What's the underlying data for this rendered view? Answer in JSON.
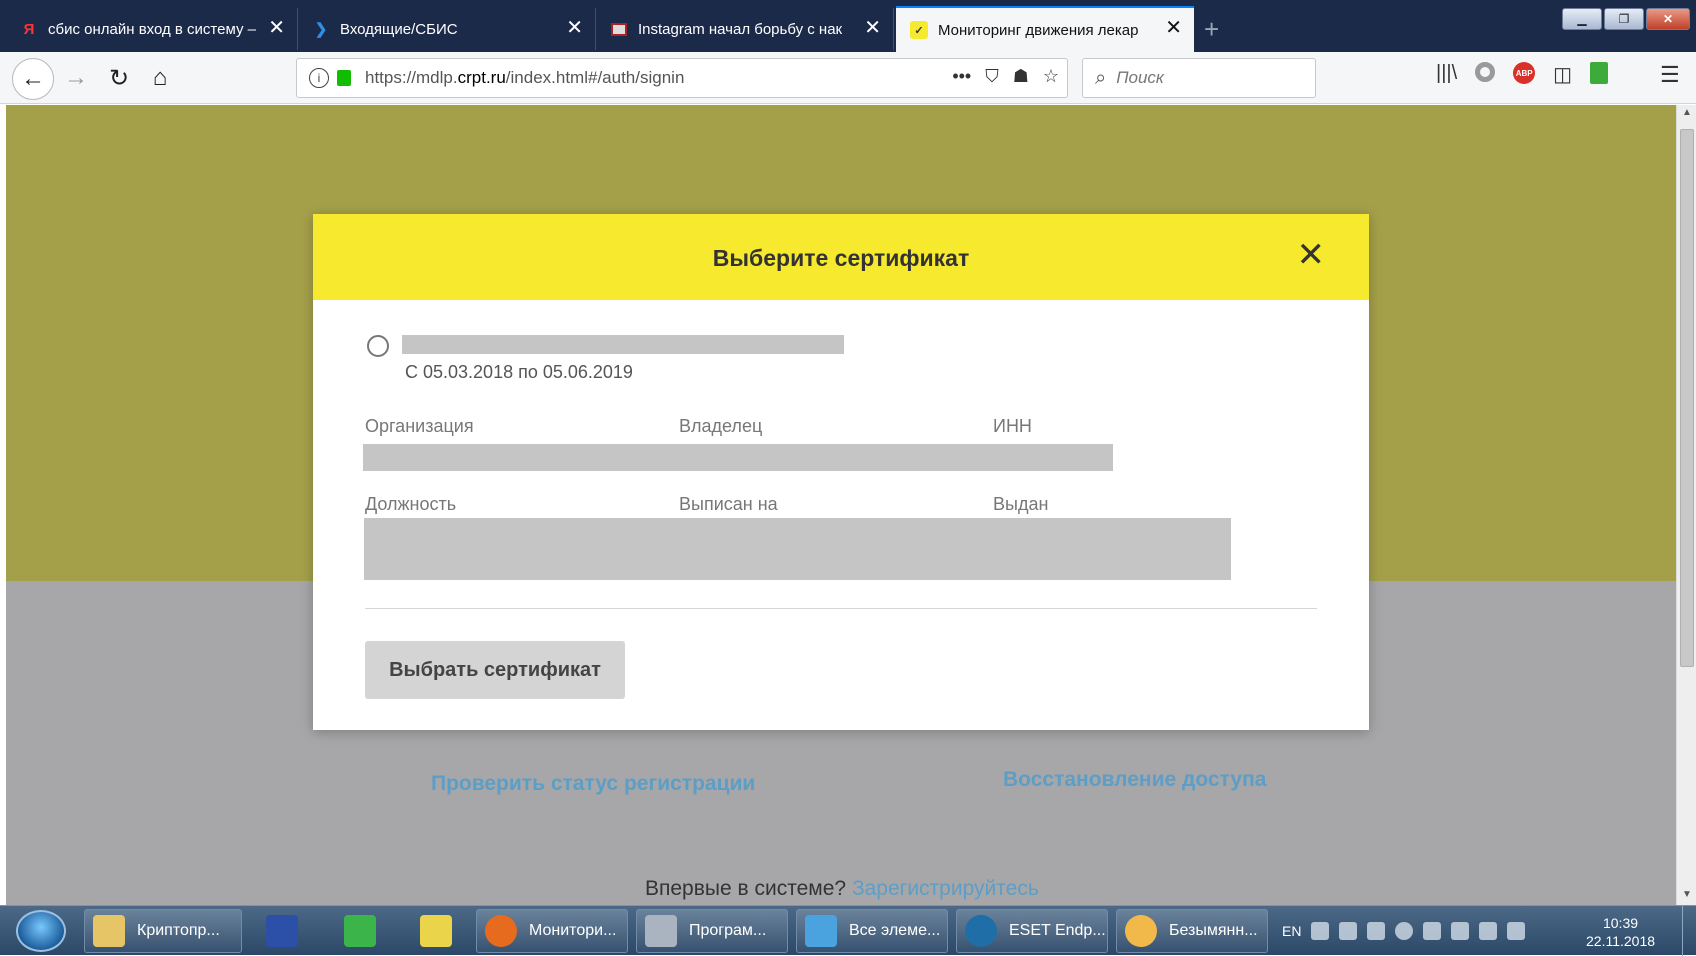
{
  "browser": {
    "tabs": [
      {
        "title": "сбис онлайн вход в систему – ",
        "icon": "yandex-icon"
      },
      {
        "title": "Входящие/СБИС",
        "icon": "sbis-icon"
      },
      {
        "title": "Instagram начал борьбу с нак",
        "icon": "news-icon"
      },
      {
        "title": "Мониторинг движения лекар",
        "icon": "mdlp-icon"
      }
    ],
    "new_tab": "+",
    "url_prefix": "https://mdlp.",
    "url_domain": "crpt.ru",
    "url_suffix": "/index.html#/auth/signin",
    "search_placeholder": "Поиск"
  },
  "modal": {
    "title": "Выберите сертификат",
    "close": "✕",
    "period": "С 05.03.2018 по 05.06.2019",
    "labels": {
      "organization": "Организация",
      "owner": "Владелец",
      "inn": "ИНН",
      "position": "Должность",
      "issued_to": "Выписан на",
      "issued_by": "Выдан"
    },
    "choose_button": "Выбрать сертификат"
  },
  "page": {
    "check_status_link": "Проверить статус регистрации",
    "restore_access_link": "Восстановление доступа",
    "first_time_text": "Впервые в системе?",
    "register_link": "Зарегистрируйтесь"
  },
  "taskbar": {
    "items": [
      {
        "label": "Криптопр..."
      },
      {
        "label": "Монитори..."
      },
      {
        "label": "Програм..."
      },
      {
        "label": "Все элеме..."
      },
      {
        "label": "ESET Endp..."
      },
      {
        "label": "Безымянн..."
      }
    ],
    "lang": "EN",
    "time": "10:39",
    "date": "22.11.2018"
  },
  "colors": {
    "header_yellow": "#f6e92e",
    "page_olive": "#a4a04a",
    "link_blue": "#5c9ec6"
  }
}
